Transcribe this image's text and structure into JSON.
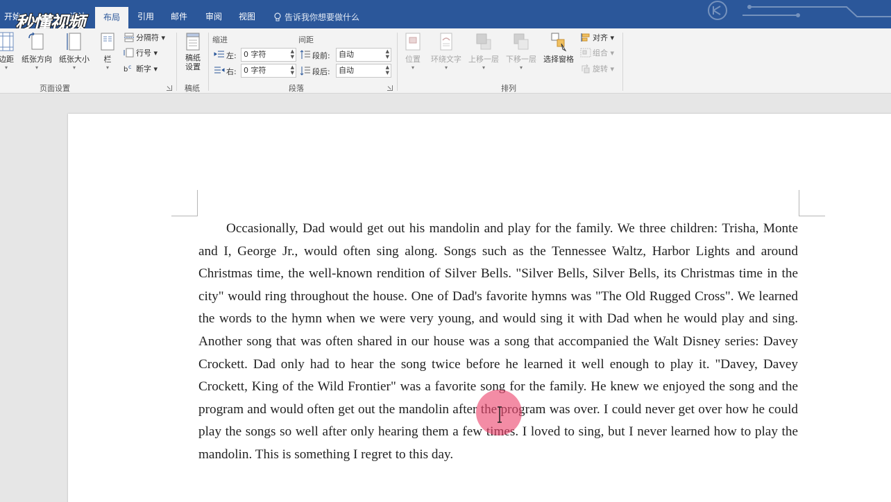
{
  "tabs": [
    {
      "label": "开始",
      "active": false
    },
    {
      "label": "设计",
      "active": false
    },
    {
      "label": "布局",
      "active": true
    },
    {
      "label": "引用",
      "active": false
    },
    {
      "label": "邮件",
      "active": false
    },
    {
      "label": "审阅",
      "active": false
    },
    {
      "label": "视图",
      "active": false
    }
  ],
  "tell_me": "告诉我你想要做什么",
  "watermark": "秒懂视频",
  "ribbon": {
    "page_setup": {
      "label": "页面设置",
      "margins": "边距",
      "orientation": "纸张方向",
      "size": "纸张大小",
      "columns": "栏",
      "breaks": "分隔符",
      "line_numbers": "行号",
      "hyphenation": "断字"
    },
    "draft": {
      "label": "稿纸",
      "settings_line1": "稿纸",
      "settings_line2": "设置"
    },
    "paragraph": {
      "label": "段落",
      "indent_header": "缩进",
      "spacing_header": "间距",
      "left_label": "左:",
      "right_label": "右:",
      "left_value": "0 字符",
      "right_value": "0 字符",
      "before_label": "段前:",
      "after_label": "段后:",
      "before_value": "自动",
      "after_value": "自动"
    },
    "arrange": {
      "label": "排列",
      "position": "位置",
      "wrap_text": "环绕文字",
      "bring_forward": "上移一层",
      "send_backward": "下移一层",
      "selection_pane": "选择窗格",
      "align": "对齐",
      "group": "组合",
      "rotate": "旋转"
    }
  },
  "document": {
    "paragraph": "Occasionally, Dad would get out his mandolin and play for the family. We three children: Trisha, Monte and I, George Jr., would often sing along. Songs such as the Tennessee Waltz, Harbor Lights and around Christmas time, the well-known rendition of Silver Bells. \"Silver Bells, Silver Bells, its Christmas time in the city\" would ring throughout the house. One of Dad's favorite hymns was \"The Old Rugged Cross\". We learned the words to the hymn when we were very young, and would sing it with Dad when he would play and sing. Another song that was often shared in our house was a song that accompanied the Walt Disney series: Davey Crockett. Dad only had to hear the song twice before he learned it well enough to play it. \"Davey, Davey Crockett, King of the Wild Frontier\" was a favorite song for the family. He knew we enjoyed the song and the program and would often get out the mandolin after the program was over. I could never get over how he could play the songs so well after only hearing them a few times. I loved to sing, but I never learned how to play the mandolin. This is something I regret to this day."
  },
  "colors": {
    "accent": "#2b579a",
    "ribbon_bg": "#f3f3f3",
    "canvas_bg": "#e6e6e6",
    "click_highlight": "#ec466e"
  }
}
